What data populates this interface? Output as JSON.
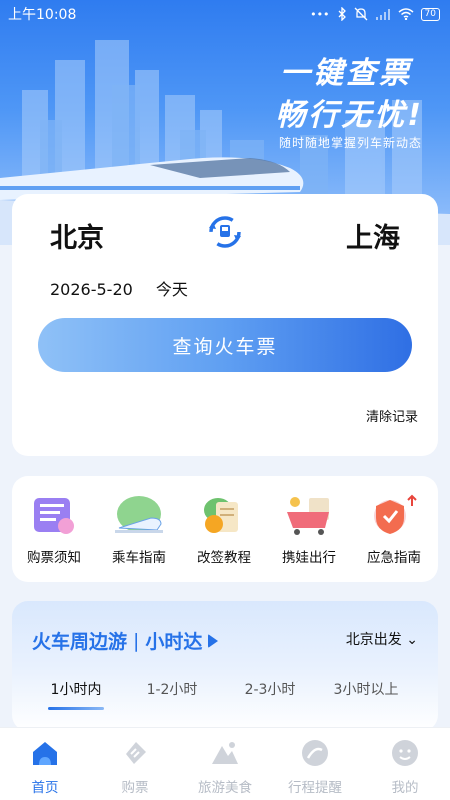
{
  "status_bar": {
    "time": "上午10:08",
    "signal_dots": "•••",
    "battery": "70"
  },
  "hero": {
    "title_line1": "一键查票",
    "title_line2": "畅行无忧!",
    "subtitle": "随时随地掌握列车新动态",
    "colors": {
      "sky_top": "#2f7cf0",
      "sky_bottom": "#9cc5fb"
    }
  },
  "search": {
    "from_city": "北京",
    "to_city": "上海",
    "date": "2026-5-20",
    "day_label": "今天",
    "query_button": "查询火车票",
    "clear_history": "清除记录",
    "swap_icon": "swap-icon"
  },
  "quick_links": [
    {
      "label": "购票须知",
      "icon": "ticket-notice-icon"
    },
    {
      "label": "乘车指南",
      "icon": "train-guide-icon"
    },
    {
      "label": "改签教程",
      "icon": "rebook-tutorial-icon"
    },
    {
      "label": "携娃出行",
      "icon": "travel-with-kids-icon"
    },
    {
      "label": "应急指南",
      "icon": "emergency-guide-icon"
    }
  ],
  "trip_section": {
    "title_main": "火车周边游",
    "title_sub": "小时达",
    "depart_from": "北京出发",
    "tabs": [
      "1小时内",
      "1-2小时",
      "2-3小时",
      "3小时以上"
    ],
    "active_tab": 0
  },
  "bottom_nav": [
    {
      "label": "首页",
      "icon": "home-icon",
      "active": true
    },
    {
      "label": "购票",
      "icon": "ticket-icon",
      "active": false
    },
    {
      "label": "旅游美食",
      "icon": "mountain-icon",
      "active": false
    },
    {
      "label": "行程提醒",
      "icon": "itinerary-icon",
      "active": false
    },
    {
      "label": "我的",
      "icon": "profile-icon",
      "active": false
    }
  ],
  "accent_color": "#2672e8"
}
